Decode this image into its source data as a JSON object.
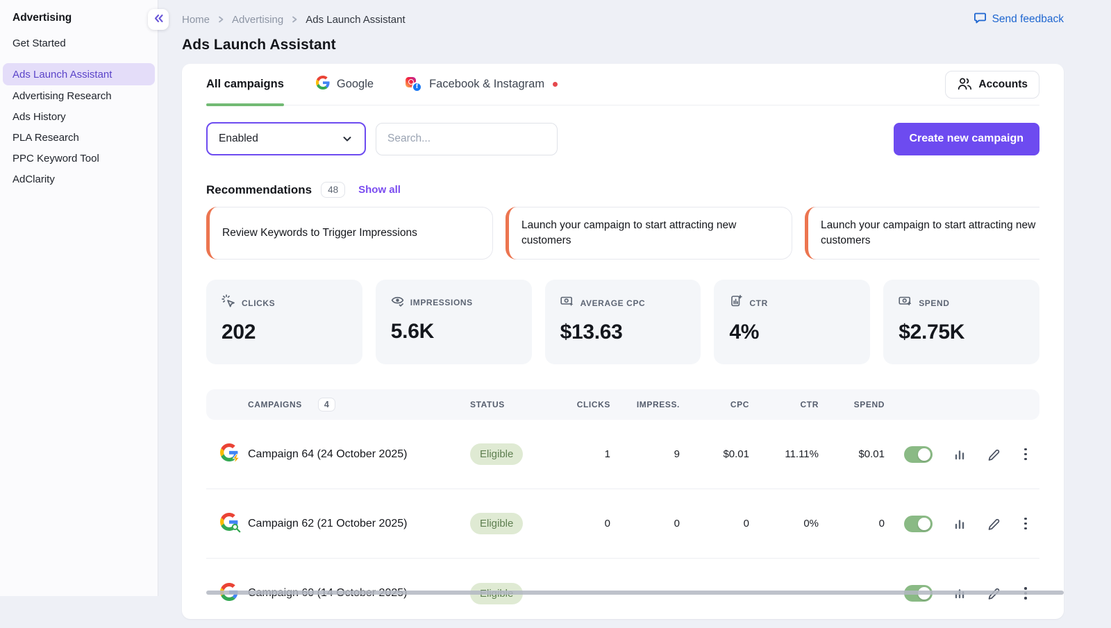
{
  "sidebar": {
    "title": "Advertising",
    "items": [
      {
        "label": "Get Started",
        "active": false
      },
      {
        "label": "Ads Launch Assistant",
        "active": true
      },
      {
        "label": "Advertising Research",
        "active": false
      },
      {
        "label": "Ads History",
        "active": false
      },
      {
        "label": "PLA Research",
        "active": false
      },
      {
        "label": "PPC Keyword Tool",
        "active": false
      },
      {
        "label": "AdClarity",
        "active": false
      }
    ]
  },
  "header": {
    "breadcrumb": [
      "Home",
      "Advertising",
      "Ads Launch Assistant"
    ],
    "feedback_label": "Send feedback",
    "page_title": "Ads Launch Assistant"
  },
  "tabs": {
    "all_campaigns": "All campaigns",
    "google": "Google",
    "facebook_instagram": "Facebook & Instagram",
    "accounts_label": "Accounts"
  },
  "toolbar": {
    "status_filter_value": "Enabled",
    "search_placeholder": "Search...",
    "create_campaign_label": "Create new campaign"
  },
  "recommendations": {
    "title": "Recommendations",
    "count": "48",
    "show_all_label": "Show all",
    "cards": [
      {
        "text": "Review Keywords to Trigger Impressions"
      },
      {
        "text": "Launch your campaign to start attracting new customers"
      },
      {
        "text": "Launch your campaign to start attracting new customers"
      }
    ]
  },
  "stats": [
    {
      "icon": "cursor-click-icon",
      "label": "CLICKS",
      "value": "202"
    },
    {
      "icon": "eye-icon",
      "label": "IMPRESSIONS",
      "value": "5.6K"
    },
    {
      "icon": "money-cursor-icon",
      "label": "AVERAGE CPC",
      "value": "$13.63"
    },
    {
      "icon": "bar-chart-doc-icon",
      "label": "CTR",
      "value": "4%"
    },
    {
      "icon": "money-plus-icon",
      "label": "SPEND",
      "value": "$2.75K"
    }
  ],
  "table": {
    "headers": {
      "campaigns": "CAMPAIGNS",
      "campaigns_count": "4",
      "status": "STATUS",
      "clicks": "CLICKS",
      "impressions": "IMPRESS.",
      "cpc": "CPC",
      "ctr": "CTR",
      "spend": "SPEND"
    },
    "rows": [
      {
        "icon": "google-performance-max-icon",
        "name": "Campaign 64 (24 October 2025)",
        "status": "Eligible",
        "clicks": "1",
        "impressions": "9",
        "cpc": "$0.01",
        "ctr": "11.11%",
        "spend": "$0.01",
        "enabled": true
      },
      {
        "icon": "google-search-campaign-icon",
        "name": "Campaign 62 (21 October 2025)",
        "status": "Eligible",
        "clicks": "0",
        "impressions": "0",
        "cpc": "0",
        "ctr": "0%",
        "spend": "0",
        "enabled": true
      },
      {
        "icon": "google-campaign-icon",
        "name": "Campaign 60 (14 October 2025)",
        "status": "Eligible",
        "clicks": "",
        "impressions": "",
        "cpc": "",
        "ctr": "",
        "spend": "",
        "enabled": true,
        "partially_visible": true
      }
    ]
  },
  "colors": {
    "accent_purple": "#6d4bf0",
    "tab_indicator_green": "#72ba74",
    "recommendation_accent_orange": "#ec7550",
    "eligible_badge_bg": "#dfead3",
    "eligible_badge_text": "#5e7f50",
    "toggle_on_green": "#8aba85",
    "feedback_blue": "#1e66d0",
    "notification_red": "#e5484d",
    "sidebar_active_bg": "#e4ddf9",
    "sidebar_active_text": "#5b44c9"
  }
}
